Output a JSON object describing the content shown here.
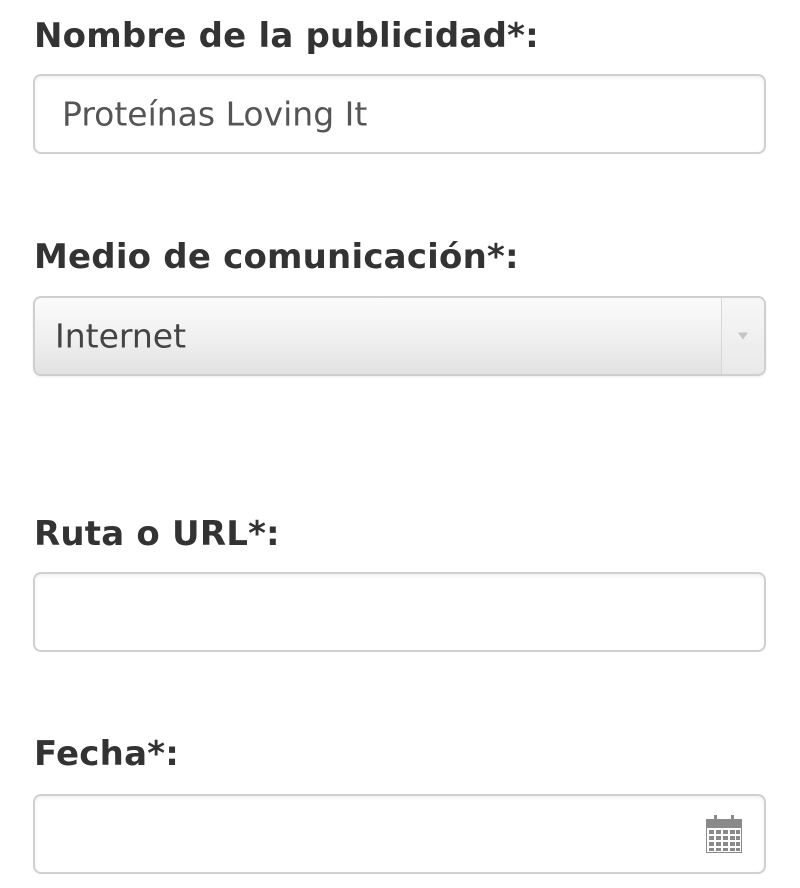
{
  "form": {
    "ad_name": {
      "label": "Nombre de la publicidad*:",
      "value": "Proteínas Loving It"
    },
    "media": {
      "label": "Medio de comunicación*:",
      "selected": "Internet"
    },
    "url": {
      "label": "Ruta o URL*:",
      "value": ""
    },
    "date": {
      "label": "Fecha*:",
      "value": ""
    }
  },
  "icons": {
    "select_arrow": "chevron-down-icon",
    "date_picker": "calendar-icon"
  },
  "colors": {
    "label": "#333333",
    "border": "#d0d0d0",
    "icon": "#8a8a8a"
  }
}
